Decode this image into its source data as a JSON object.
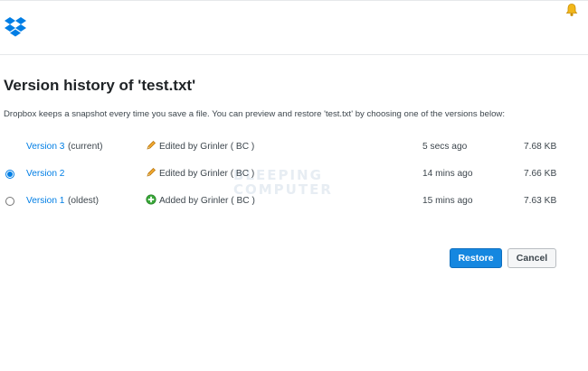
{
  "header": {
    "logo_icon": "dropbox-logo-icon",
    "notification_icon": "bell-icon",
    "brand_color": "#007ee5"
  },
  "title": "Version history of 'test.txt'",
  "description": "Dropbox keeps a snapshot every time you save a file. You can preview and restore 'test.txt' by choosing one of the versions below:",
  "versions": [
    {
      "label": "Version 3",
      "tag": "(current)",
      "action_icon": "pencil-icon",
      "action": "Edited by Grinler ( BC )",
      "time": "5 secs ago",
      "size": "7.68 KB",
      "selected": false,
      "has_radio": false
    },
    {
      "label": "Version 2",
      "tag": "",
      "action_icon": "pencil-icon",
      "action": "Edited by Grinler ( BC )",
      "time": "14 mins ago",
      "size": "7.66 KB",
      "selected": true,
      "has_radio": true
    },
    {
      "label": "Version 1",
      "tag": "(oldest)",
      "action_icon": "plus-circle-icon",
      "action": "Added by Grinler ( BC )",
      "time": "15 mins ago",
      "size": "7.63 KB",
      "selected": false,
      "has_radio": true
    }
  ],
  "watermark": {
    "line1": "BLEEPING",
    "line2": "COMPUTER"
  },
  "buttons": {
    "restore": "Restore",
    "cancel": "Cancel"
  }
}
